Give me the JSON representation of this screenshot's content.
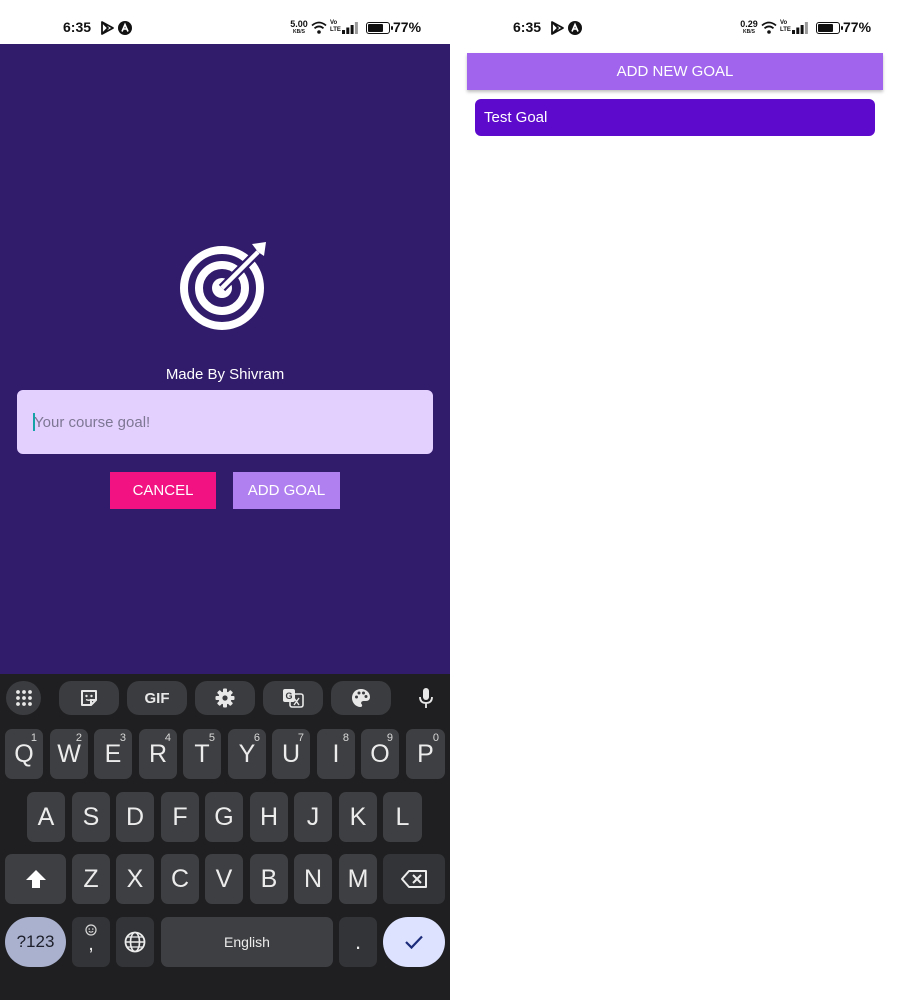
{
  "left_screen": {
    "status_bar": {
      "time": "6:35",
      "net_speed_value": "5.00",
      "net_speed_unit": "KB/S",
      "lte": "Vo\nLTE",
      "battery_percent": "77%",
      "battery_level": 0.77
    },
    "made_by": "Made By Shivram",
    "goal_input": {
      "value": "",
      "placeholder": "Your course goal!"
    },
    "cancel_label": "CANCEL",
    "add_goal_label": "ADD GOAL",
    "keyboard": {
      "toolbar": [
        "apps-grid-icon",
        "sticker-icon",
        "GIF",
        "gear-icon",
        "translate-icon",
        "palette-icon",
        "microphone-icon"
      ],
      "gif_label": "GIF",
      "row1": [
        {
          "k": "Q",
          "h": "1"
        },
        {
          "k": "W",
          "h": "2"
        },
        {
          "k": "E",
          "h": "3"
        },
        {
          "k": "R",
          "h": "4"
        },
        {
          "k": "T",
          "h": "5"
        },
        {
          "k": "Y",
          "h": "6"
        },
        {
          "k": "U",
          "h": "7"
        },
        {
          "k": "I",
          "h": "8"
        },
        {
          "k": "O",
          "h": "9"
        },
        {
          "k": "P",
          "h": "0"
        }
      ],
      "row2": [
        "A",
        "S",
        "D",
        "F",
        "G",
        "H",
        "J",
        "K",
        "L"
      ],
      "row3": [
        "Z",
        "X",
        "C",
        "V",
        "B",
        "N",
        "M"
      ],
      "symbols_label": "?123",
      "comma_label": ",",
      "space_label": "English",
      "period_label": "."
    }
  },
  "right_screen": {
    "status_bar": {
      "time": "6:35",
      "net_speed_value": "0.29",
      "net_speed_unit": "KB/S",
      "lte": "Vo\nLTE",
      "battery_percent": "77%",
      "battery_level": 0.77
    },
    "add_new_goal_label": "ADD NEW GOAL",
    "goals": [
      "Test Goal"
    ]
  },
  "colors": {
    "modal_background": "#311b6b",
    "input_background": "#e4d0ff",
    "cancel_button": "#f31282",
    "add_goal_button": "#b180f0",
    "add_new_goal_button": "#a065ec",
    "goal_item": "#5e0acc"
  }
}
